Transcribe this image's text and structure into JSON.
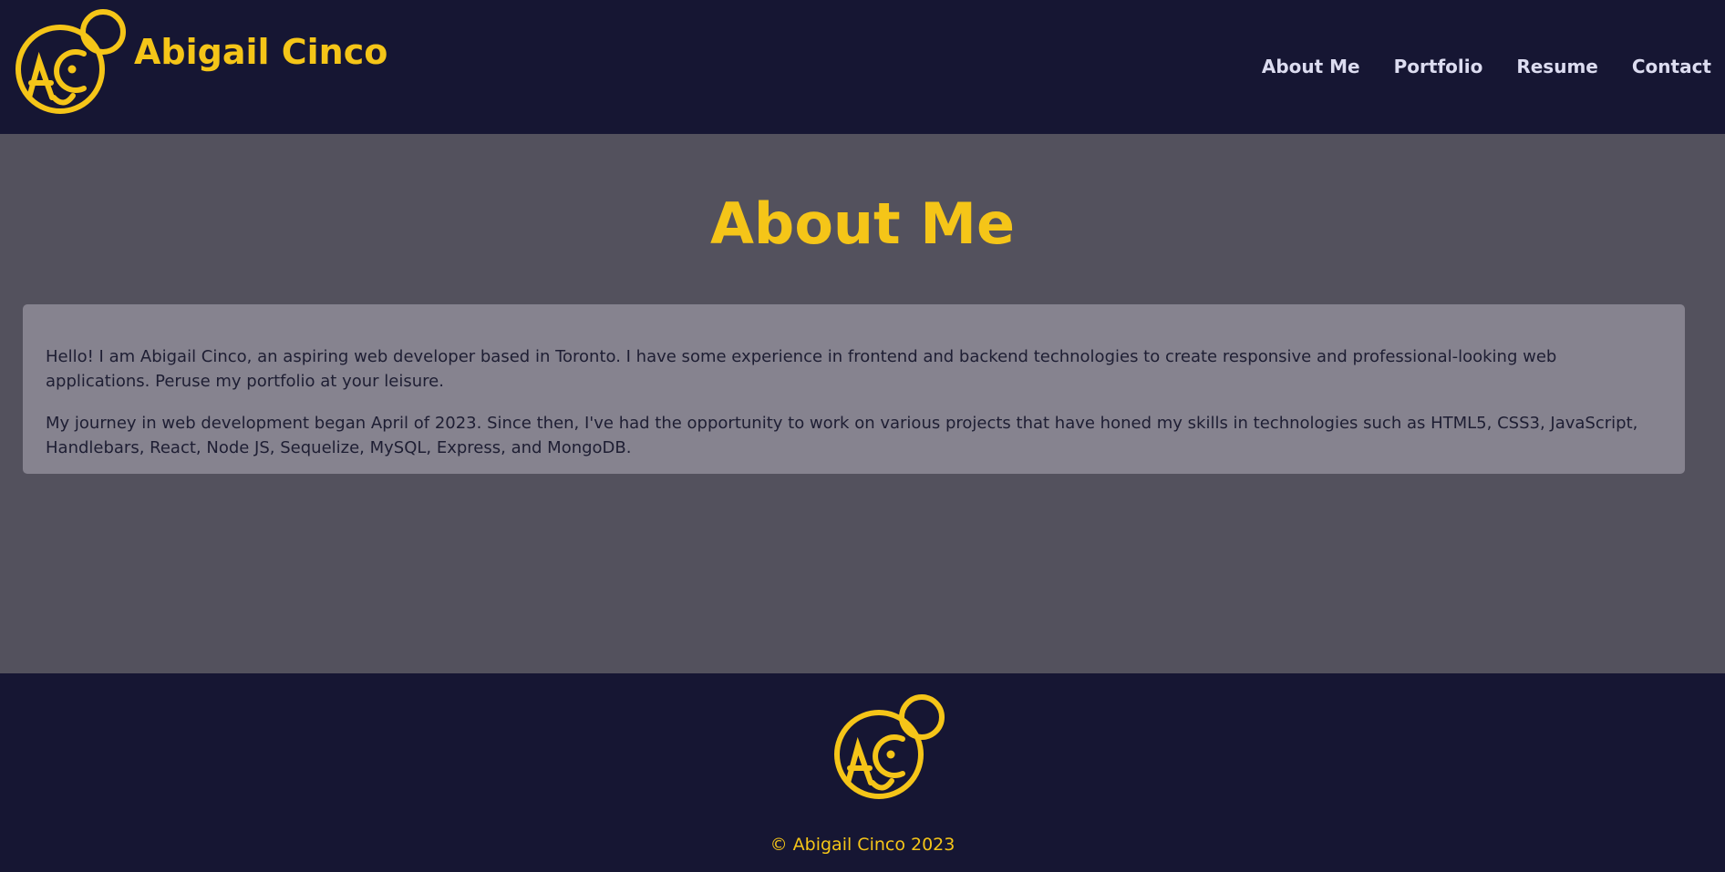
{
  "header": {
    "brand_name": "Abigail Cinco",
    "logo_icon": "ac-monogram-face-logo",
    "nav": [
      {
        "label": "About Me"
      },
      {
        "label": "Portfolio"
      },
      {
        "label": "Resume"
      },
      {
        "label": "Contact"
      }
    ]
  },
  "main": {
    "title": "About Me",
    "paragraphs": [
      "Hello! I am Abigail Cinco, an aspiring web developer based in Toronto. I have some experience in frontend and backend technologies to create responsive and professional-looking web applications. Peruse my portfolio at your leisure.",
      "My journey in web development began April of 2023. Since then, I've had the opportunity to work on various projects that have honed my skills in technologies such as HTML5, CSS3, JavaScript, Handlebars, React, Node JS, Sequelize, MySQL, Express, and MongoDB."
    ]
  },
  "footer": {
    "logo_icon": "ac-monogram-face-logo",
    "copyright": "© Abigail Cinco 2023"
  },
  "colors": {
    "header_bg": "#161633",
    "main_bg": "#53515d",
    "card_bg": "#86838f",
    "accent": "#f5c518",
    "nav_text": "#dcdcf0",
    "body_text": "#1e1e33"
  }
}
